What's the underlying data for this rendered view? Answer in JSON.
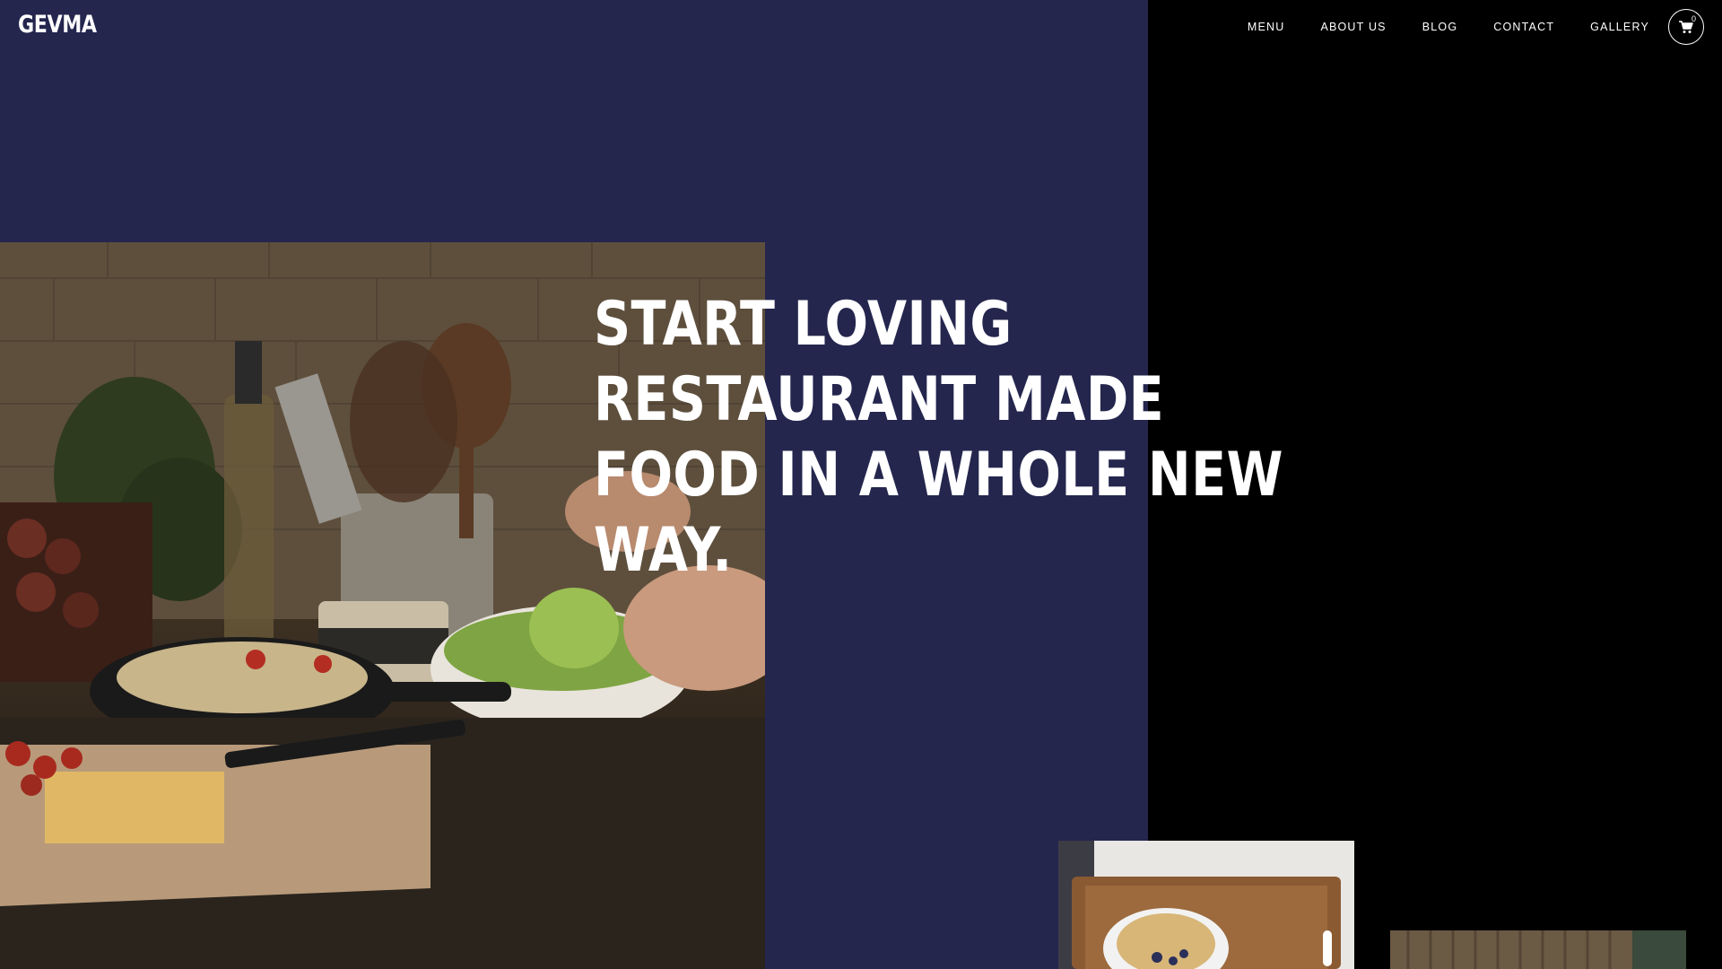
{
  "brand": {
    "logo": "GEVMA"
  },
  "nav": {
    "items": [
      {
        "label": "MENU"
      },
      {
        "label": "ABOUT US"
      },
      {
        "label": "BLOG"
      },
      {
        "label": "CONTACT"
      },
      {
        "label": "GALLERY"
      }
    ],
    "cart_count": "0",
    "cart_icon": "cart-icon"
  },
  "hero": {
    "headline_lines": [
      "START LOVING",
      "RESTAURANT MADE",
      "FOOD IN A WHOLE NEW",
      "WAY."
    ],
    "image_alt": "kitchen-cooking-photo"
  },
  "gallery": {
    "thumbs": [
      {
        "image": "breakfast-tray-photo"
      },
      {
        "image": "restaurant-interior-photo"
      }
    ]
  },
  "colors": {
    "panel": "#24264e",
    "background": "#000000",
    "text": "#ffffff"
  }
}
